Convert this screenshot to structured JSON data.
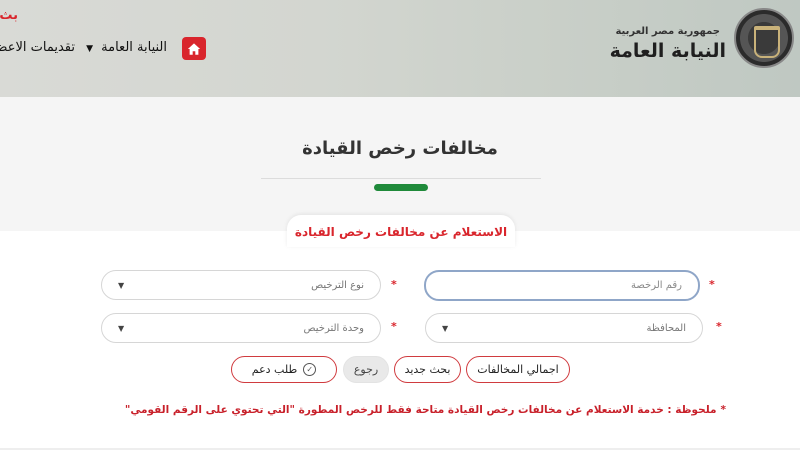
{
  "header": {
    "brand_sub": "جمهورية مصر العربية",
    "brand_main": "النيابة العامة",
    "nav": [
      {
        "label": "النيابة العامة"
      },
      {
        "label": "تقديمات الاعض"
      }
    ],
    "top_cut_text": "بث"
  },
  "page": {
    "title": "مخالفات رخص القيادة",
    "card_label": "الاستعلام عن مخالفات رخص القيادة"
  },
  "form": {
    "license_number_placeholder": "رقم الرخصة",
    "license_type_label": "نوع الترخيص",
    "governorate_label": "المحافظة",
    "licensing_unit_label": "وحدة الترخيص",
    "required_mark": "*"
  },
  "buttons": {
    "total": "اجمالي المخالفات",
    "new_search": "بحث جديد",
    "back": "رجوع",
    "support": "طلب دعم"
  },
  "note": {
    "star": "*",
    "text": "ملحوظة : خدمة الاستعلام عن مخالفات رخص القيادة متاحة فقط للرخص المطورة \"التي تحتوي على الرقم القومي\""
  },
  "colors": {
    "accent_red": "#d9252c",
    "accent_green": "#1f8a3a"
  }
}
